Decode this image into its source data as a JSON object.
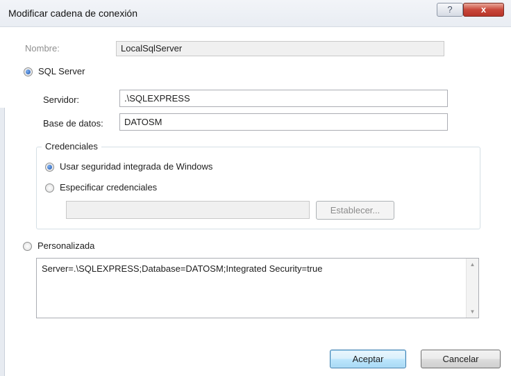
{
  "window": {
    "title": "Modificar cadena de conexión",
    "help_glyph": "?",
    "close_glyph": "x"
  },
  "name": {
    "label": "Nombre:",
    "value": "LocalSqlServer"
  },
  "sqlserver": {
    "option_label": "SQL Server",
    "selected": true,
    "server_label": "Servidor:",
    "server_value": ".\\SQLEXPRESS",
    "database_label": "Base de datos:",
    "database_value": "DATOSM"
  },
  "credentials": {
    "group_label": "Credenciales",
    "integrated_label": "Usar seguridad integrada de Windows",
    "integrated_selected": true,
    "specify_label": "Especificar credenciales",
    "specify_selected": false,
    "credentials_value": "",
    "set_button": "Establecer..."
  },
  "custom": {
    "option_label": "Personalizada",
    "selected": false,
    "connection_string": "Server=.\\SQLEXPRESS;Database=DATOSM;Integrated Security=true",
    "scroll_up_glyph": "▲",
    "scroll_down_glyph": "▼"
  },
  "footer": {
    "accept_button": "Aceptar",
    "cancel_button": "Cancelar"
  }
}
